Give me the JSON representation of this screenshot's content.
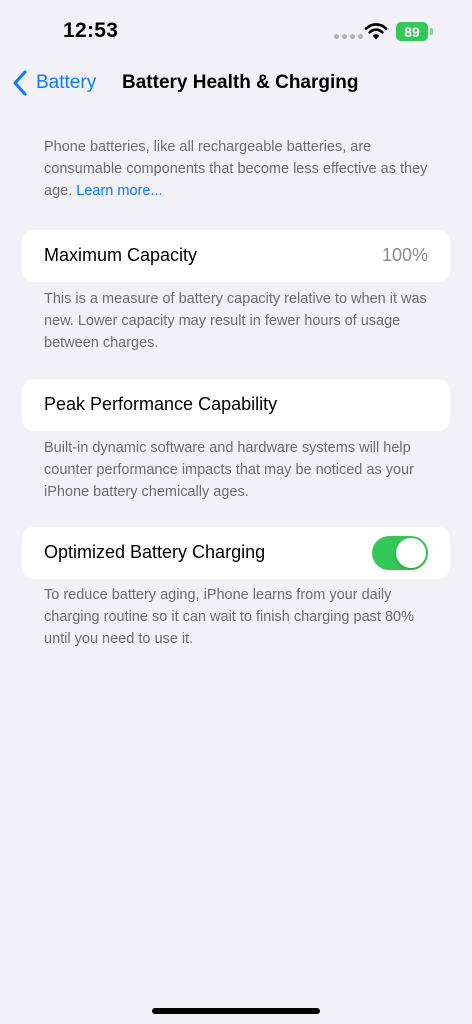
{
  "status_bar": {
    "time": "12:53",
    "battery_level": "89"
  },
  "nav": {
    "back_label": "Battery",
    "title": "Battery Health & Charging"
  },
  "intro": {
    "text": "Phone batteries, like all rechargeable batteries, are consumable components that become less effective as they age.",
    "link": "Learn more..."
  },
  "max_capacity": {
    "label": "Maximum Capacity",
    "value": "100%",
    "footnote": "This is a measure of battery capacity relative to when it was new. Lower capacity may result in fewer hours of usage between charges."
  },
  "peak_performance": {
    "label": "Peak Performance Capability",
    "footnote": "Built-in dynamic software and hardware systems will help counter performance impacts that may be noticed as your iPhone battery chemically ages."
  },
  "optimized_charging": {
    "label": "Optimized Battery Charging",
    "enabled": true,
    "footnote": "To reduce battery aging, iPhone learns from your daily charging routine so it can wait to finish charging past 80% until you need to use it."
  },
  "colors": {
    "accent": "#0a7aff",
    "toggle_on": "#34c759",
    "background": "#f2f1f7"
  }
}
